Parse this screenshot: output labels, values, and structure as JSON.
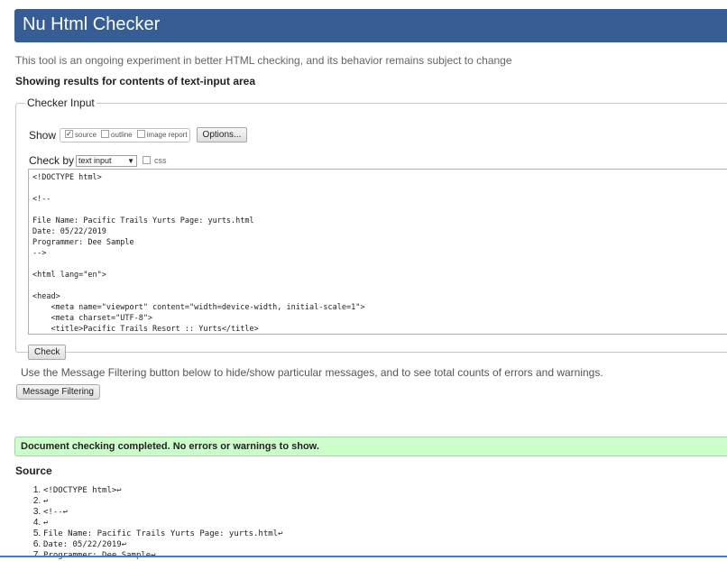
{
  "header": {
    "title": "Nu Html Checker"
  },
  "intro_text": "This tool is an ongoing experiment in better HTML checking, and its behavior remains subject to change",
  "showing_text": "Showing results for contents of text-input area",
  "checker": {
    "legend": "Checker Input",
    "show_label": "Show",
    "options": [
      {
        "label": "source",
        "checked": true
      },
      {
        "label": "outline",
        "checked": false
      },
      {
        "label": "image report",
        "checked": false
      }
    ],
    "options_button": "Options...",
    "check_by_label": "Check by",
    "check_by_value": "text input",
    "css_label": "css",
    "textarea_content": "<!DOCTYPE html>\n\n<!--\n\nFile Name: Pacific Trails Yurts Page: yurts.html\nDate: 05/22/2019\nProgrammer: Dee Sample\n-->\n\n<html lang=\"en\">\n\n<head>\n    <meta name=\"viewport\" content=\"width=device-width, initial-scale=1\">\n    <meta charset=\"UTF-8\">\n    <title>Pacific Trails Resort :: Yurts</title>",
    "check_button": "Check"
  },
  "filter": {
    "text": "Use the Message Filtering button below to hide/show particular messages, and to see total counts of errors and warnings.",
    "button": "Message Filtering"
  },
  "result": {
    "message": "Document checking completed. No errors or warnings to show."
  },
  "source": {
    "heading": "Source",
    "lines": [
      "<!DOCTYPE html>↩",
      "↩",
      "<!--↩",
      "↩",
      "File Name: Pacific Trails Yurts Page: yurts.html↩",
      "Date: 05/22/2019↩",
      "Programmer: Dee Sample↩"
    ]
  },
  "colors": {
    "header_bg": "#365d95",
    "success_bg": "#ccffcc"
  }
}
